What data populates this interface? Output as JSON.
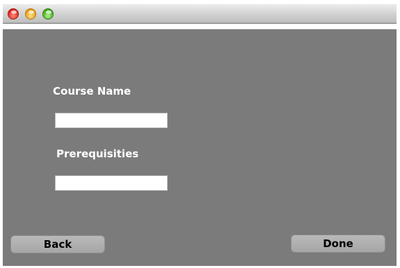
{
  "window": {
    "controls": {
      "close_icon": "close-circle-red",
      "minimize_icon": "minimize-circle-yellow",
      "zoom_icon": "zoom-circle-green"
    },
    "background_color": "#7b7b7b"
  },
  "form": {
    "course_name_label": "Course Name",
    "course_name_value": "",
    "prerequisites_label": "Prerequisities",
    "prerequisites_value": ""
  },
  "buttons": {
    "back_label": "Back",
    "done_label": "Done"
  }
}
